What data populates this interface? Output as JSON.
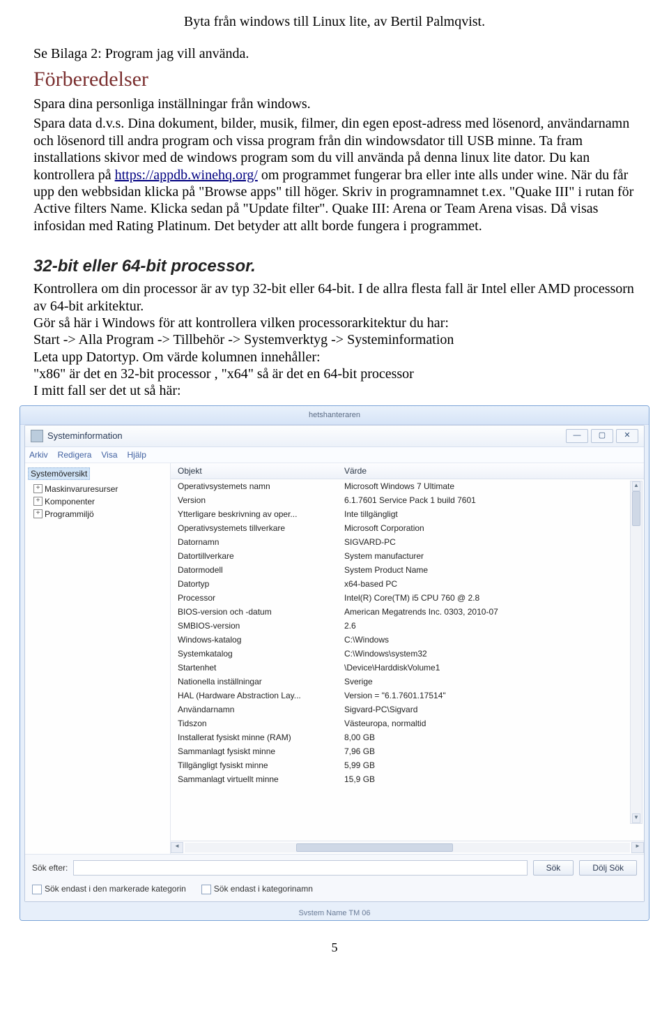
{
  "doc": {
    "title": "Byta från windows till Linux lite, av Bertil Palmqvist.",
    "bilaga": "Se Bilaga 2: Program jag vill använda.",
    "h_forberedelser": "Förberedelser",
    "para1_a": "Spara dina personliga inställningar från windows.",
    "para1_b": "Spara data d.v.s. Dina dokument, bilder, musik, filmer, din egen epost-adress med lösenord, användarnamn och lösenord till andra program och vissa program från din windowsdator till USB minne. Ta fram installations skivor med de windows program som du vill använda på denna linux lite dator. Du kan kontrollera på ",
    "link_text": "https://appdb.winehq.org/",
    "para1_c": "  om programmet fungerar bra eller inte alls under wine. När du får upp den webbsidan klicka på \"Browse apps\" till höger. Skriv in programnamnet t.ex. \"Quake III\" i rutan för Active filters Name. Klicka sedan på \"Update filter\". Quake III: Arena or Team Arena visas. Då visas  infosidan med Rating Platinum. Det betyder att allt borde fungera i programmet.",
    "h_32bit": "32-bit eller 64-bit processor.",
    "para2": "Kontrollera om din processor är av typ 32-bit eller 64-bit. I de allra flesta fall är Intel eller AMD processorn av 64-bit arkitektur.\nGör så här i Windows för att kontrollera vilken processorarkitektur du har:\nStart -> Alla Program -> Tillbehör -> Systemverktyg -> Systeminformation\nLeta upp Datortyp. Om värde kolumnen innehåller:\n \"x86\" är det en 32-bit processor , \"x64\" så är det en 64-bit processor\nI mitt fall ser det ut så här:",
    "page_number": "5"
  },
  "sysinfo": {
    "task_tab": "hetshanteraren",
    "window_title": "Systeminformation",
    "menu": [
      "Arkiv",
      "Redigera",
      "Visa",
      "Hjälp"
    ],
    "tree_root": "Systemöversikt",
    "tree_nodes": [
      "Maskinvaruresurser",
      "Komponenter",
      "Programmiljö"
    ],
    "col_obj": "Objekt",
    "col_val": "Värde",
    "rows": [
      {
        "o": "Operativsystemets namn",
        "v": "Microsoft Windows 7 Ultimate"
      },
      {
        "o": "Version",
        "v": "6.1.7601 Service Pack 1 build 7601"
      },
      {
        "o": "Ytterligare beskrivning av oper...",
        "v": "Inte tillgängligt"
      },
      {
        "o": "Operativsystemets tillverkare",
        "v": "Microsoft Corporation"
      },
      {
        "o": "Datornamn",
        "v": "SIGVARD-PC"
      },
      {
        "o": "Datortillverkare",
        "v": "System manufacturer"
      },
      {
        "o": "Datormodell",
        "v": "System Product Name"
      },
      {
        "o": "Datortyp",
        "v": "x64-based PC"
      },
      {
        "o": "Processor",
        "v": "Intel(R) Core(TM) i5 CPU         760  @ 2.8"
      },
      {
        "o": "BIOS-version och -datum",
        "v": "American Megatrends Inc. 0303, 2010-07"
      },
      {
        "o": "SMBIOS-version",
        "v": "2.6"
      },
      {
        "o": "Windows-katalog",
        "v": "C:\\Windows"
      },
      {
        "o": "Systemkatalog",
        "v": "C:\\Windows\\system32"
      },
      {
        "o": "Startenhet",
        "v": "\\Device\\HarddiskVolume1"
      },
      {
        "o": "Nationella inställningar",
        "v": "Sverige"
      },
      {
        "o": "HAL (Hardware Abstraction Lay...",
        "v": "Version = \"6.1.7601.17514\""
      },
      {
        "o": "Användarnamn",
        "v": "Sigvard-PC\\Sigvard"
      },
      {
        "o": "Tidszon",
        "v": "Västeuropa, normaltid"
      },
      {
        "o": "Installerat fysiskt minne (RAM)",
        "v": "8,00 GB"
      },
      {
        "o": "Sammanlagt fysiskt minne",
        "v": "7,96 GB"
      },
      {
        "o": "Tillgängligt fysiskt minne",
        "v": "5,99 GB"
      },
      {
        "o": "Sammanlagt virtuellt minne",
        "v": "15,9 GB"
      }
    ],
    "search_label": "Sök efter:",
    "btn_search": "Sök",
    "btn_hide": "Dölj Sök",
    "opt1": "Sök endast i den markerade kategorin",
    "opt2": "Sök endast i kategorinamn",
    "bottom": "Svstem Name                TM 06"
  }
}
